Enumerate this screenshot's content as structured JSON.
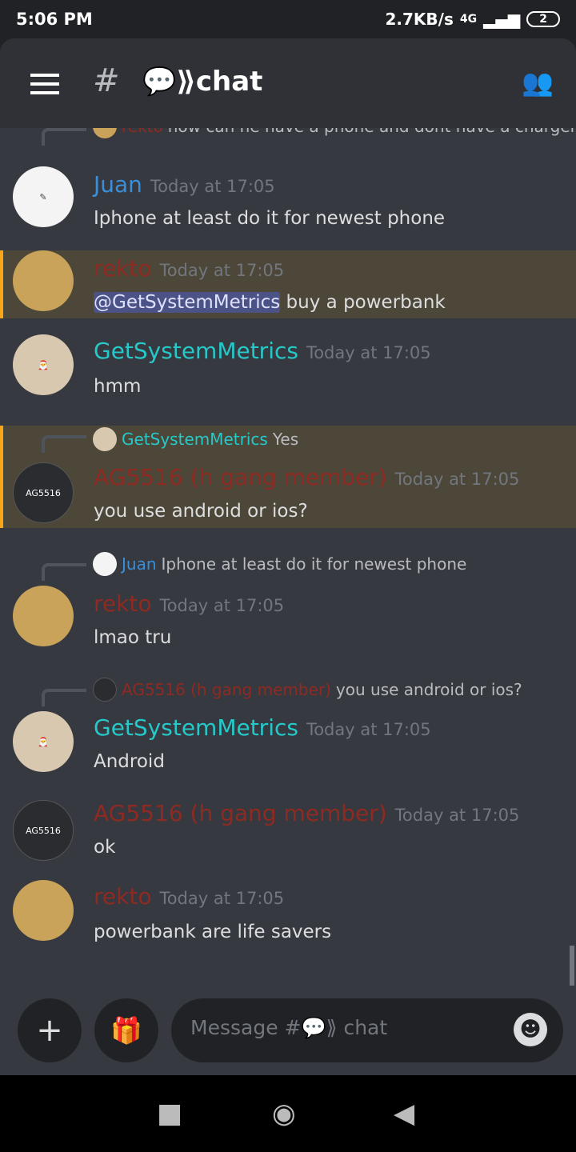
{
  "status_bar": {
    "time": "5:06 PM",
    "speed": "2.7KB/s",
    "network": "4G",
    "battery": "2"
  },
  "header": {
    "channel_name": "💬⟫chat"
  },
  "colors": {
    "juan": "#3b8ed8",
    "getsystemmetrics": "#25c9c9",
    "red_role": "#8f2a22",
    "highlight": "#faa61a"
  },
  "messages": [
    {
      "reply": {
        "author": "rekto",
        "text": "how can he have a phone and dont have a charger"
      }
    },
    {
      "author": "Juan",
      "time": "Today at 17:05",
      "text": "Iphone at least do it for newest phone"
    },
    {
      "author": "rekto",
      "time": "Today at 17:05",
      "mention": "@GetSystemMetrics",
      "text": " buy a powerbank"
    },
    {
      "author": "GetSystemMetrics",
      "time": "Today at 17:05",
      "text": "hmm"
    },
    {
      "reply": {
        "author": "GetSystemMetrics",
        "text": "Yes"
      },
      "author": "AG5516 (h gang member)",
      "avatar_text": "AG5516",
      "time": "Today at 17:05",
      "text": "you use android or ios?"
    },
    {
      "reply": {
        "author": "Juan",
        "text": "Iphone at least do it for newest phone"
      },
      "author": "rekto",
      "time": "Today at 17:05",
      "text": "lmao tru"
    },
    {
      "reply": {
        "author": "AG5516 (h gang member)",
        "text": "you use android or ios?"
      },
      "author": "GetSystemMetrics",
      "time": "Today at 17:05",
      "text": "Android"
    },
    {
      "author": "AG5516 (h gang member)",
      "avatar_text": "AG5516",
      "time": "Today at 17:05",
      "text": "ok"
    },
    {
      "author": "rekto",
      "time": "Today at 17:05",
      "text": "powerbank are life savers"
    }
  ],
  "composer": {
    "placeholder": "Message #💬⟫ chat"
  }
}
